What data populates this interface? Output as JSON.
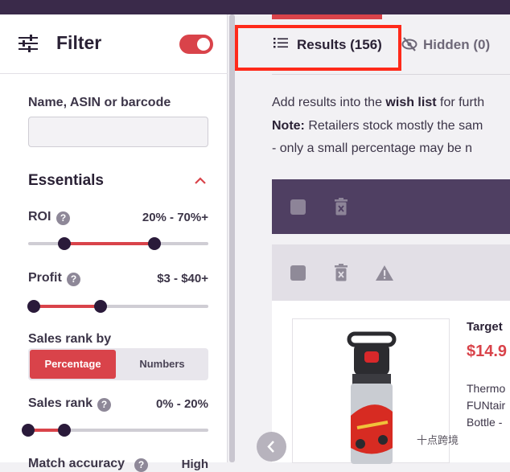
{
  "filter": {
    "title": "Filter",
    "toggle_on": true,
    "name_label": "Name, ASIN or barcode",
    "name_value": "",
    "essentials": "Essentials",
    "roi": {
      "label": "ROI",
      "help": "?",
      "range": "20% - 70%+",
      "low": 0.2,
      "high": 0.7
    },
    "profit": {
      "label": "Profit",
      "help": "?",
      "range": "$3 - $40+",
      "low": 0.03,
      "high": 0.4
    },
    "sales_rank_by": {
      "label": "Sales rank by",
      "options": [
        "Percentage",
        "Numbers"
      ],
      "selected": "Percentage"
    },
    "sales_rank": {
      "label": "Sales rank",
      "help": "?",
      "range": "0% - 20%",
      "low": 0.0,
      "high": 0.2
    },
    "match_accuracy": {
      "label": "Match accuracy",
      "help": "?",
      "value": "High"
    }
  },
  "tabs": {
    "results": "Results (156)",
    "hidden": "Hidden (0)"
  },
  "info": {
    "line1_pre": "Add results into the ",
    "line1_bold": "wish list",
    "line1_post": " for furth",
    "line2_bold": "Note:",
    "line2_post": " Retailers stock mostly the sam",
    "line3": "- only a small percentage may be n"
  },
  "product": {
    "store": "Target",
    "price": "$14.9",
    "desc_lines": [
      "Thermo",
      "FUNtair",
      "Bottle -"
    ]
  },
  "watermark": "十点跨境",
  "colors": {
    "accent": "#d9434a",
    "dark": "#2a1a3a",
    "bulkbar": "#4f3f62",
    "highlight": "#ff2a1a"
  }
}
